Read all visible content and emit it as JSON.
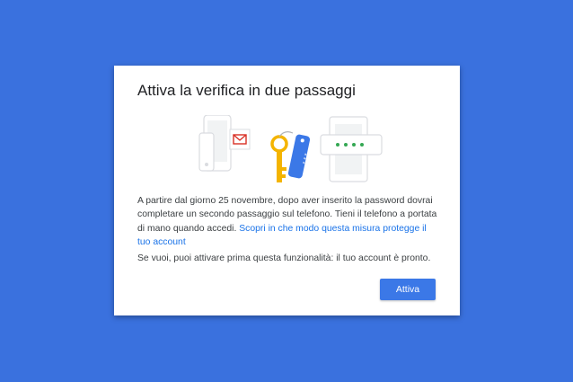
{
  "dialog": {
    "title": "Attiva la verifica in due passaggi",
    "body_text": "A partire dal giorno 25 novembre, dopo aver inserito la password dovrai completare un secondo passaggio sul telefono. Tieni il telefono a portata di mano quando accedi.",
    "learn_more_link": "Scopri in che modo questa misura protegge il tuo account",
    "secondary_text": "Se vuoi, puoi attivare prima questa funzionalità: il tuo account è pronto.",
    "activate_button_label": "Attiva"
  },
  "illustration": {
    "code_tag_text": "* * *",
    "icons": [
      "phone-icon",
      "mail-icon",
      "key-icon",
      "password-tag-icon",
      "laptop-icon"
    ]
  },
  "colors": {
    "background": "#3a71de",
    "primary": "#3b78e7",
    "link": "#1a73e8",
    "key": "#f4b400",
    "mail": "#d93025",
    "dots": "#34a853"
  }
}
